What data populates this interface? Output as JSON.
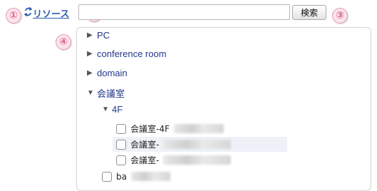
{
  "badges": [
    "①",
    "②",
    "③",
    "④"
  ],
  "resource_link": "リソース",
  "search": {
    "value": "",
    "placeholder": "",
    "button_label": "検索"
  },
  "tree": {
    "nodes": [
      {
        "label": "PC",
        "arrow": "▶"
      },
      {
        "label": "conference room",
        "arrow": "▶"
      },
      {
        "label": "domain",
        "arrow": "▶"
      },
      {
        "label": "会議室",
        "arrow": "▼"
      },
      {
        "label": "4F",
        "arrow": "▼"
      }
    ],
    "rooms": [
      "会議室-4F",
      "会議室-",
      "会議室-"
    ],
    "partial_item": "ba"
  },
  "colors": {
    "link": "#2a5db0",
    "node_label": "#23378a",
    "badge": "#d9658f"
  }
}
